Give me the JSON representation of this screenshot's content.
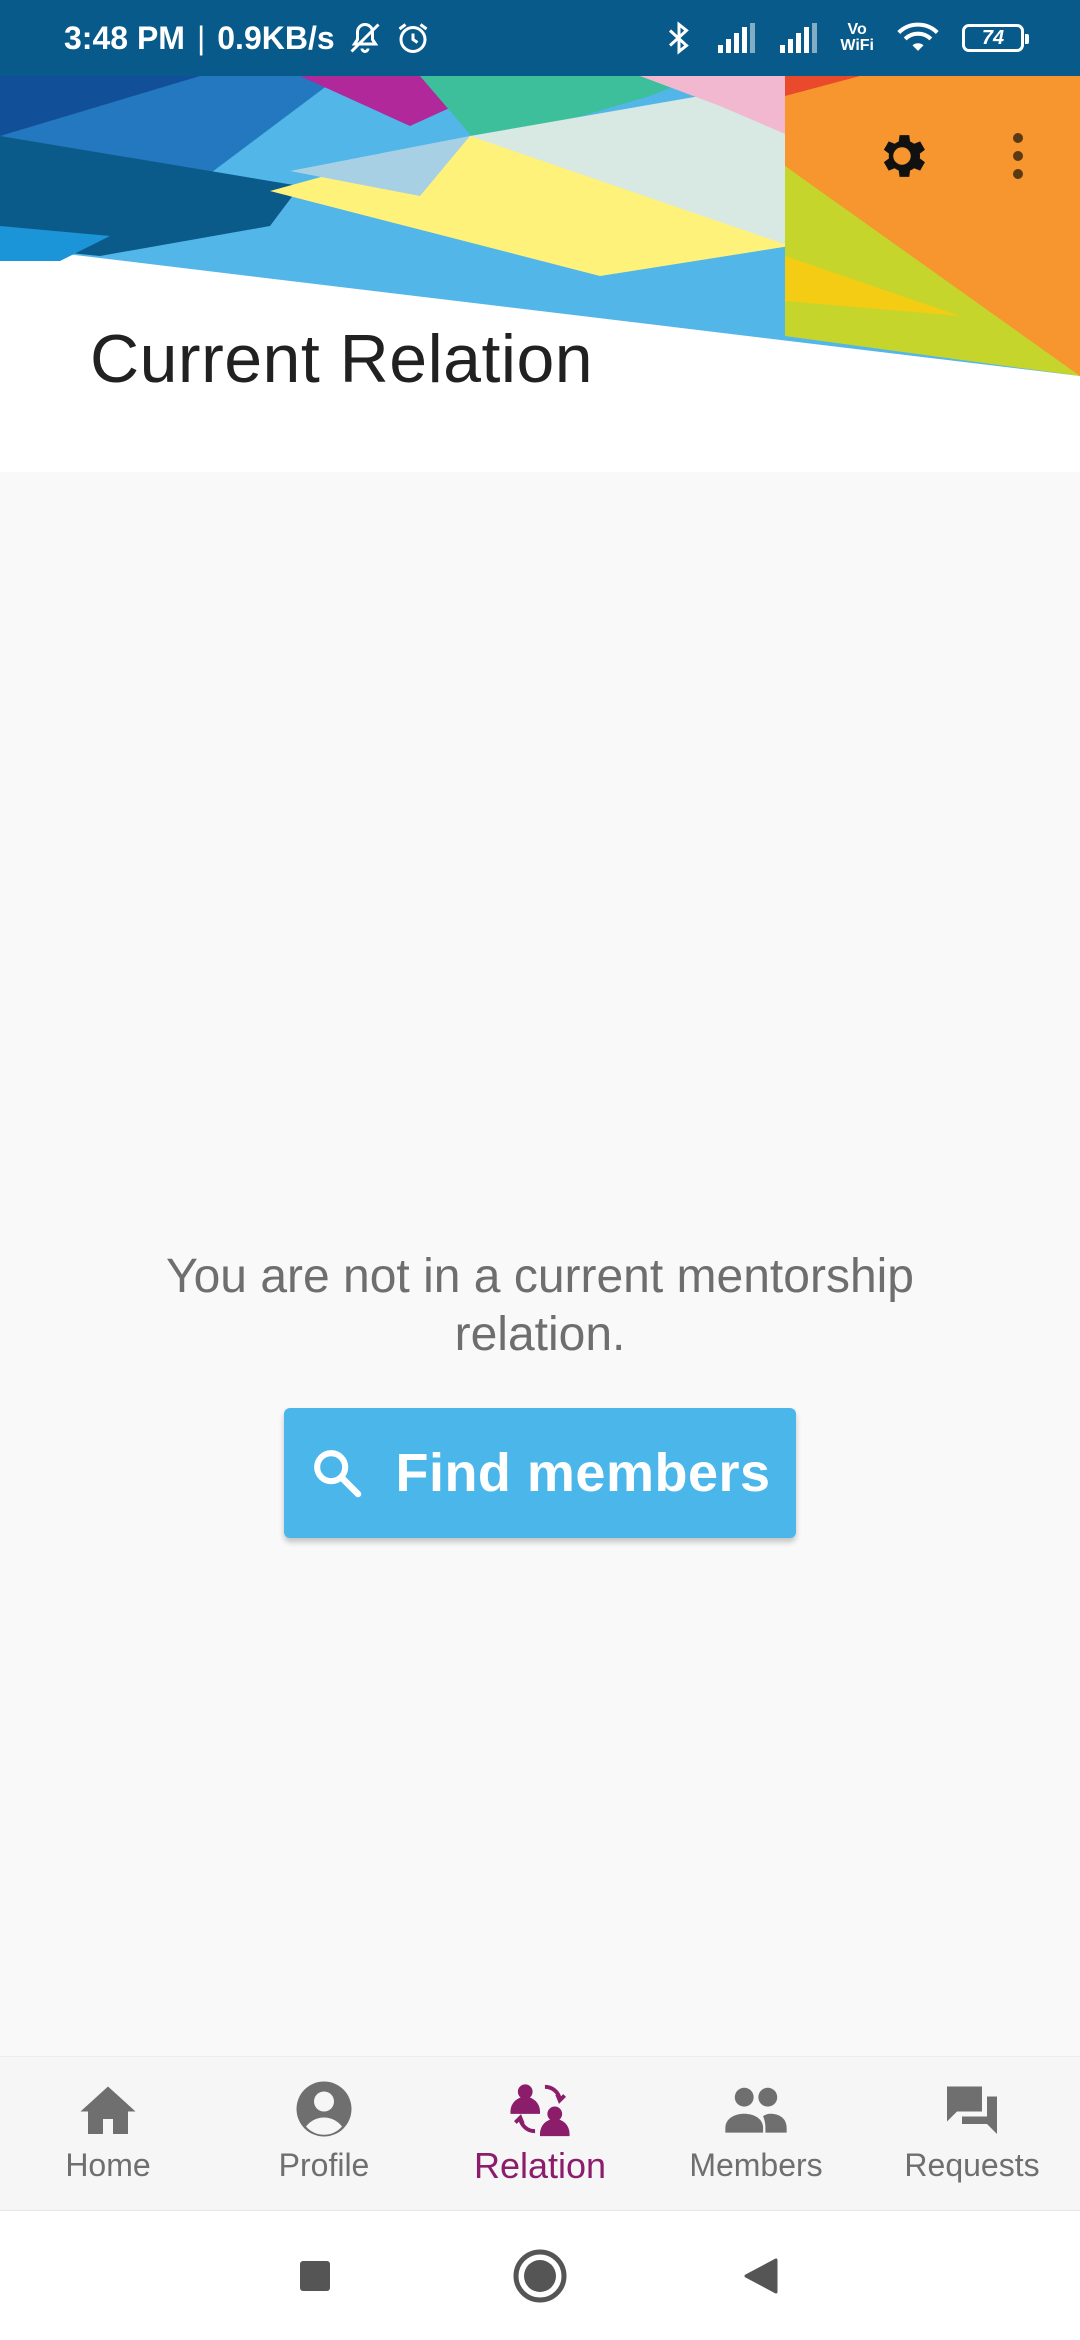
{
  "status_bar": {
    "time": "3:48 PM",
    "separator": "|",
    "network_speed": "0.9KB/s",
    "battery_level": "74",
    "vowifi_top": "Vo",
    "vowifi_bottom": "WiFi",
    "icons": [
      "muted-bell-icon",
      "alarm-icon",
      "bluetooth-icon",
      "signal-icon",
      "signal-icon",
      "vowifi-icon",
      "wifi-icon",
      "battery-icon"
    ]
  },
  "header": {
    "title": "Current Relation",
    "actions": [
      "settings-gear-icon",
      "more-vert-icon"
    ]
  },
  "main": {
    "empty_message": "You are not in a current mentorship relation.",
    "find_members_button": {
      "label": "Find members",
      "icon": "search-icon"
    }
  },
  "bottom_nav": {
    "items": [
      {
        "label": "Home",
        "icon": "home-icon"
      },
      {
        "label": "Profile",
        "icon": "account-circle-icon"
      },
      {
        "label": "Relation",
        "icon": "relation-icon",
        "active": true
      },
      {
        "label": "Members",
        "icon": "people-icon"
      },
      {
        "label": "Requests",
        "icon": "forum-icon"
      }
    ]
  },
  "system_nav": {
    "buttons": [
      "recents-square-icon",
      "home-circle-icon",
      "back-triangle-icon"
    ]
  },
  "colors": {
    "status_bar": "#075a8a",
    "accent": "#4bb6ea",
    "active_nav": "#8b1d6b",
    "nav_inactive": "#6f6f6f",
    "banner_orange": "#f7962f"
  }
}
